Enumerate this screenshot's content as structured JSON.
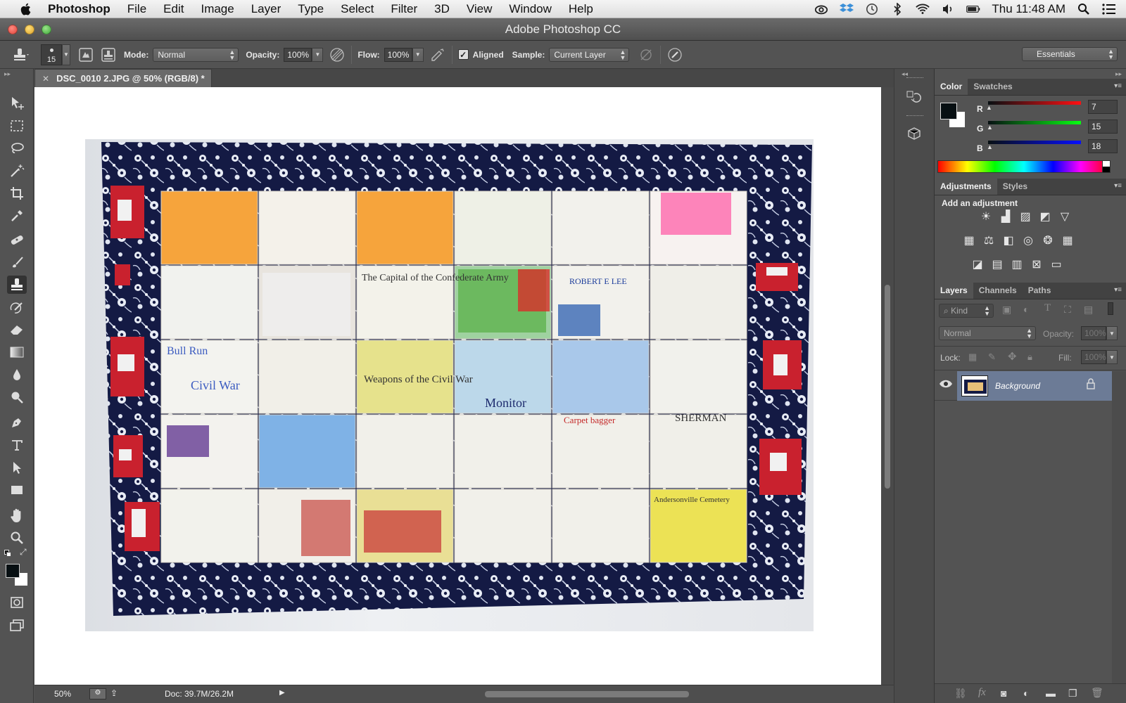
{
  "menubar": {
    "app_name": "Photoshop",
    "items": [
      "File",
      "Edit",
      "Image",
      "Layer",
      "Type",
      "Select",
      "Filter",
      "3D",
      "View",
      "Window",
      "Help"
    ],
    "clock": "Thu 11:48 AM"
  },
  "window": {
    "title": "Adobe Photoshop CC"
  },
  "options_bar": {
    "brush_size": "15",
    "mode_label": "Mode:",
    "mode_value": "Normal",
    "opacity_label": "Opacity:",
    "opacity_value": "100%",
    "flow_label": "Flow:",
    "flow_value": "100%",
    "aligned_label": "Aligned",
    "aligned_checked": true,
    "sample_label": "Sample:",
    "sample_value": "Current Layer",
    "workspace": "Essentials"
  },
  "document": {
    "tab_title": "DSC_0010 2.JPG @ 50% (RGB/8) *",
    "zoom": "50%",
    "doc_size": "Doc: 39.7M/26.2M"
  },
  "color_panel": {
    "tabs": [
      "Color",
      "Swatches"
    ],
    "r_label": "R",
    "r_value": "7",
    "g_label": "G",
    "g_value": "15",
    "b_label": "B",
    "b_value": "18",
    "foreground": "#070f12"
  },
  "adjustments_panel": {
    "tabs": [
      "Adjustments",
      "Styles"
    ],
    "heading": "Add an adjustment"
  },
  "layers_panel": {
    "tabs": [
      "Layers",
      "Channels",
      "Paths"
    ],
    "filter_kind": "Kind",
    "blend_mode": "Normal",
    "opacity_label": "Opacity:",
    "opacity_value": "100%",
    "lock_label": "Lock:",
    "fill_label": "Fill:",
    "fill_value": "100%",
    "layers": [
      {
        "name": "Background",
        "visible": true,
        "locked": true
      }
    ]
  },
  "quilt": {
    "tiles_text": [
      "The Capital of the Confederate Army",
      "ROBERT E LEE",
      "Bull Run",
      "Civil War",
      "Weapons of the Civil War",
      "Monitor",
      "Carpet bagger",
      "SHERMAN",
      "Andersonville Cemetery"
    ]
  }
}
